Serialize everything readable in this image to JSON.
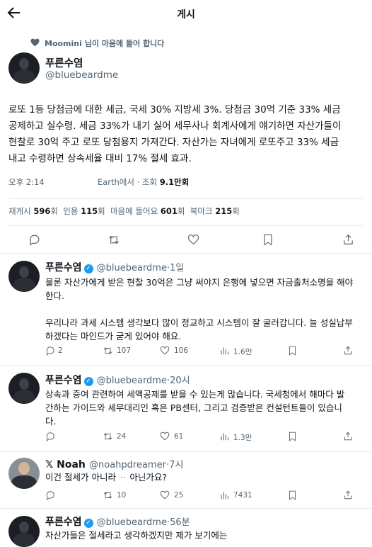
{
  "header": {
    "title": "게시"
  },
  "liked_by": {
    "text": "Moomini 님이 마음에 들어 합니다"
  },
  "main_post": {
    "name": "푸른수염",
    "handle": "@bluebeardme",
    "lines": [
      "로또 1등 당첨금에 대한 세금, 국세 30% 지방세 3%. 당첨금 30억 기준 33% 세금",
      "공제하고 실수령. 세금 33%가 내기 싫어 세무사나 회계사에게 얘기하면 자산가들이",
      "현찰로 30억 주고 로또 당첨용지 가져간다. 자산가는 자녀에게 로또주고 33% 세금",
      "내고 수령하면 상속세율 대비 17% 절세 효과."
    ],
    "time": "오후 2:14",
    "source": "Earth에서",
    "views_label": "조회",
    "views": "9.1만회",
    "stats": {
      "reposts_label": "재게시",
      "reposts": "596",
      "reposts_unit": "회",
      "quotes_label": "인용",
      "quotes": "115",
      "quotes_unit": "회",
      "likes_label": "마음에 들어요",
      "likes": "601",
      "likes_unit": "회",
      "bookmarks_label": "북마크",
      "bookmarks": "215",
      "bookmarks_unit": "회"
    }
  },
  "replies": [
    {
      "name": "푸른수염",
      "handle": "@bluebeardme",
      "time": "1일",
      "lines": [
        "물론 자산가에게 받은 현찰 30억은 그냥 써야지 은행에 넣으면 자금출처소명을 해야",
        "한다.",
        "",
        "우리나라 과세 시스템 생각보다 많이 정교하고 시스템이 잘 굴러갑니다. 늘 성실납부",
        "하겠다는 마인드가 굳게 있어야 해요."
      ],
      "counts": {
        "replies": "2",
        "reposts": "107",
        "likes": "106",
        "views": "1.6만"
      }
    },
    {
      "name": "푸른수염",
      "handle": "@bluebeardme",
      "time": "20시",
      "lines": [
        "상속과 증여 관련하여 세액공제를 받을 수 있는게 많습니다. 국세청에서 해마다 발",
        "간하는 가이드와 세무대리인 혹은 PB센터, 그리고 검증받은 컨설턴트들이 있습니",
        "다."
      ],
      "counts": {
        "replies": "",
        "reposts": "24",
        "likes": "61",
        "views": "1.3만"
      }
    },
    {
      "name": "𝕏 Noah",
      "handle": "@noahpdreamer",
      "time": "7시",
      "lines": [
        "이건 절세가 아니라 ᆢ 아닌가요?"
      ],
      "counts": {
        "replies": "",
        "reposts": "10",
        "likes": "25",
        "views": "7431"
      }
    },
    {
      "name": "푸른수염",
      "handle": "@bluebeardme",
      "time": "56분",
      "lines": [
        "자산가들은 절세라고 생각하겠지만 제가 보기에는"
      ],
      "counts": {
        "replies": "",
        "reposts": "",
        "likes": "",
        "views": ""
      }
    }
  ],
  "colors": {
    "verified": "#1d9bf0",
    "muted": "#536471",
    "text": "#0f1419"
  }
}
